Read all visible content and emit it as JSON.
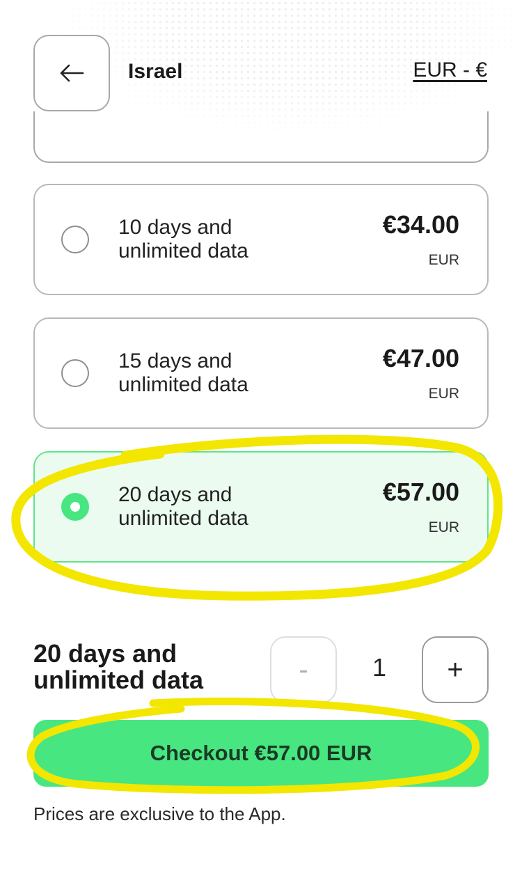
{
  "header": {
    "back_icon": "arrow-left-icon",
    "country": "Israel",
    "currency_selector": "EUR - €"
  },
  "plans": [
    {
      "label": "10 days and unlimited data",
      "price": "€34.00",
      "currency": "EUR",
      "selected": false
    },
    {
      "label": "15 days and unlimited data",
      "price": "€47.00",
      "currency": "EUR",
      "selected": false
    },
    {
      "label": "20 days and unlimited data",
      "price": "€57.00",
      "currency": "EUR",
      "selected": true
    }
  ],
  "summary": {
    "title": "20 days and unlimited data",
    "quantity": "1",
    "minus_label": "-",
    "plus_label": "+"
  },
  "checkout": {
    "label": "Checkout €57.00 EUR"
  },
  "note": "Prices are exclusive to the App.",
  "colors": {
    "accent": "#48e680",
    "selected_bg": "#ebfbf0",
    "annotation": "#f3e600"
  }
}
